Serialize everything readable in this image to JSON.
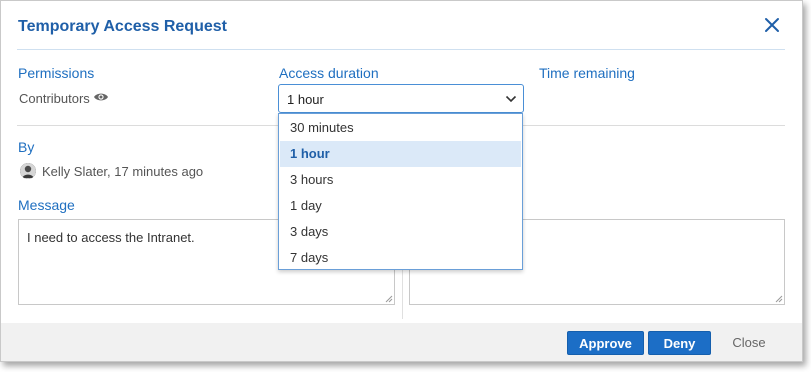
{
  "dialog": {
    "title": "Temporary Access Request"
  },
  "permissions": {
    "label": "Permissions",
    "value": "Contributors",
    "icon": "eye-icon"
  },
  "access_duration": {
    "label": "Access duration",
    "selected": "1 hour",
    "options": [
      "30 minutes",
      "1 hour",
      "3 hours",
      "1 day",
      "3 days",
      "7 days"
    ]
  },
  "time_remaining": {
    "label": "Time remaining"
  },
  "by": {
    "label": "By",
    "value": "Kelly Slater, 17 minutes ago"
  },
  "message": {
    "label": "Message",
    "value": "I need to access the Intranet."
  },
  "reply": {
    "value": ""
  },
  "footer": {
    "approve_label": "Approve",
    "deny_label": "Deny",
    "close_label": "Close"
  },
  "colors": {
    "accent": "#1f6fc0",
    "primary_button": "#1c6ec6",
    "selected_option_bg": "#dbe9f8"
  }
}
